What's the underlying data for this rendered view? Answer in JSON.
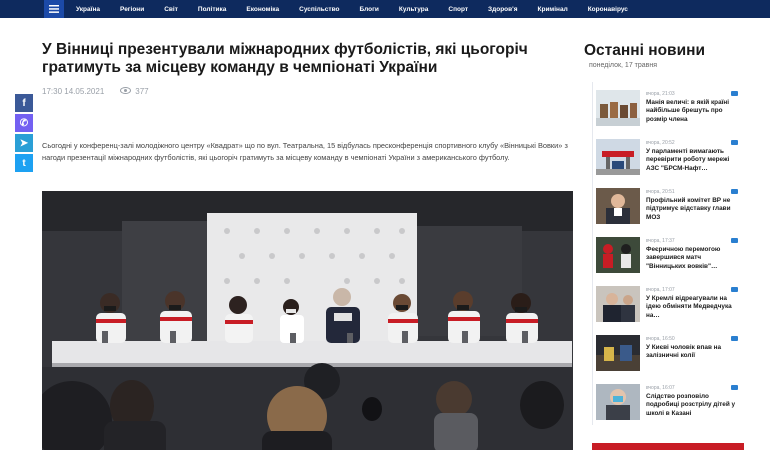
{
  "nav": {
    "items": [
      "Україна",
      "Регіони",
      "Світ",
      "Політика",
      "Економіка",
      "Суспільство",
      "Блоги",
      "Культура",
      "Спорт",
      "Здоров'я",
      "Кримінал",
      "Коронавірус"
    ]
  },
  "share": [
    {
      "icon": "facebook-icon",
      "glyph": "f",
      "color": "#3b5998"
    },
    {
      "icon": "viber-icon",
      "glyph": "✆",
      "color": "#7360f2"
    },
    {
      "icon": "telegram-icon",
      "glyph": "➤",
      "color": "#2a9fd6"
    },
    {
      "icon": "twitter-icon",
      "glyph": "t",
      "color": "#1da1f2"
    }
  ],
  "article": {
    "title": "У Вінниці презентували міжнародних футболістів, які цьогоріч гратимуть за місцеву команду в чемпіонаті України",
    "datetime": "17:30 14.05.2021",
    "views": "377",
    "lead": "Сьогодні у конференц-залі молодіжного центру «Квадрат» що по вул. Театральна, 15 відбулась пресконференція спортивного клубу «Вінницькі Вовки» з нагоди презентації міжнародних футболістів, які цьогоріч гратимуть за місцеву команду в чемпіонаті України з американського футболу."
  },
  "sidebar": {
    "title": "Останні новини",
    "date": "понеділок, 17 травня",
    "items": [
      {
        "time": "вчора, 21:03",
        "title": "Манія величі: в якій країні найбільше брешуть про розмір члена"
      },
      {
        "time": "вчора, 20:52",
        "title": "У парламенті вимагають перевірити роботу мережі АЗС \"БРСМ-Нафт…"
      },
      {
        "time": "вчора, 20:51",
        "title": "Профільний комітет ВР не підтримує відставку глави МОЗ"
      },
      {
        "time": "вчора, 17:37",
        "title": "Феєричною перемогою завершився матч \"Вінницьких вовків\"…"
      },
      {
        "time": "вчора, 17:07",
        "title": "У Кремлі відреагували на ідею обміняти Медведчука на…"
      },
      {
        "time": "вчора, 16:50",
        "title": "У Києві чоловік впав на залізничні колії"
      },
      {
        "time": "вчора, 16:07",
        "title": "Слідство розповіло подробиці розстрілу дітей у школі в Казані"
      }
    ]
  }
}
